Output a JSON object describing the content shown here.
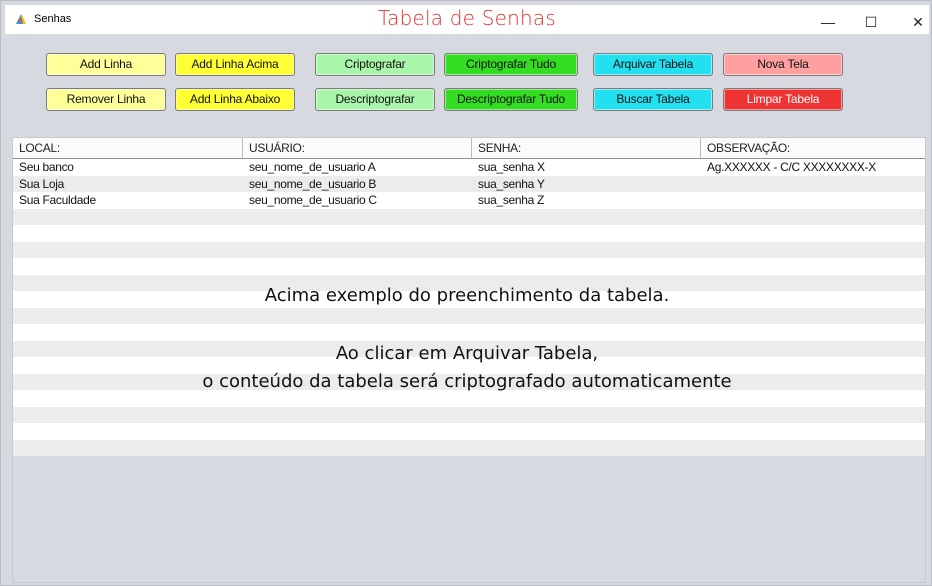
{
  "window": {
    "app_name": "Senhas",
    "title": "Tabela de Senhas",
    "controls": {
      "minimize": "—",
      "maximize": "☐",
      "close": "✕"
    }
  },
  "toolbar": {
    "row1": [
      {
        "label": "Add Linha",
        "color": "#ffff99"
      },
      {
        "label": "Add Linha Acima",
        "color": "#ffff33"
      },
      {
        "label": "Criptografar",
        "color": "#a9f5a9"
      },
      {
        "label": "Criptografar Tudo",
        "color": "#33dd22"
      },
      {
        "label": "Arquivar Tabela",
        "color": "#22e0f0"
      },
      {
        "label": "Nova Tela",
        "color": "#ffa0a0"
      }
    ],
    "row2": [
      {
        "label": "Remover Linha",
        "color": "#ffff99"
      },
      {
        "label": "Add Linha Abaixo",
        "color": "#ffff33"
      },
      {
        "label": "Descriptografar",
        "color": "#a9f5a9"
      },
      {
        "label": "Descriptografar Tudo",
        "color": "#33dd22"
      },
      {
        "label": "Buscar Tabela",
        "color": "#22e0f0"
      },
      {
        "label": "Limpar Tabela",
        "color": "#ee3333"
      }
    ]
  },
  "table": {
    "columns": [
      "LOCAL:",
      "USUÁRIO:",
      "SENHA:",
      "OBSERVAÇÃO:"
    ],
    "rows": [
      [
        "Seu banco",
        "seu_nome_de_usuario A",
        "sua_senha X",
        "Ag.XXXXXX - C/C  XXXXXXXX-X"
      ],
      [
        "Sua Loja",
        "seu_nome_de_usuario B",
        "sua_senha Y",
        ""
      ],
      [
        "Sua Faculdade",
        "seu_nome_de_usuario C",
        "sua_senha Z",
        ""
      ]
    ]
  },
  "overlay": {
    "line1": "Acima exemplo do preenchimento da tabela.",
    "line2": "Ao clicar em Arquivar Tabela,",
    "line3": "o conteúdo da tabela será criptografado automaticamente"
  },
  "colors": {
    "title": "#e0312b",
    "row_alt": "#ececec",
    "row_base": "#ffffff"
  }
}
